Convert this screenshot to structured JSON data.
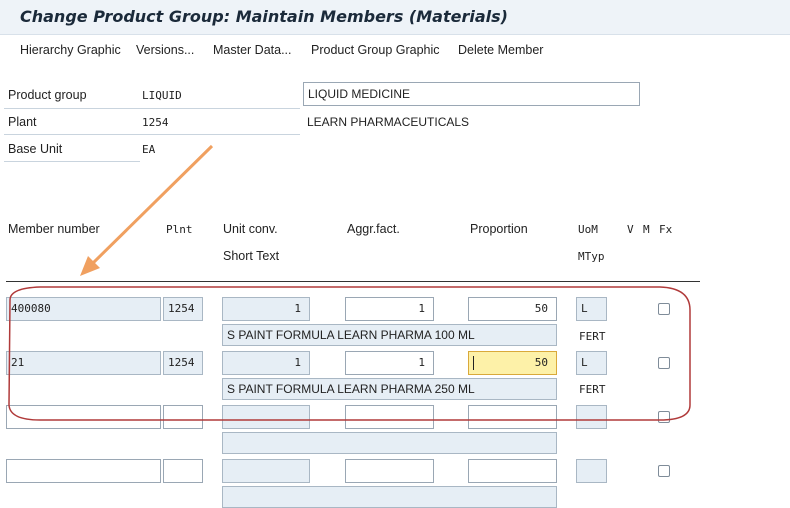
{
  "title": "Change Product Group: Maintain Members (Materials)",
  "menu": [
    "Hierarchy Graphic",
    "Versions...",
    "Master Data...",
    "Product Group Graphic",
    "Delete Member"
  ],
  "header": {
    "product_group_label": "Product group",
    "product_group_value": "LIQUID",
    "product_group_desc": "LIQUID MEDICINE",
    "plant_label": "Plant",
    "plant_value": "1254",
    "plant_desc": "LEARN PHARMACEUTICALS",
    "base_unit_label": "Base Unit",
    "base_unit_value": "EA"
  },
  "columns": {
    "member_number": "Member number",
    "plnt": "Plnt",
    "unit_conv": "Unit conv.",
    "aggr_fact": "Aggr.fact.",
    "proportion": "Proportion",
    "uom": "UoM",
    "v": "V",
    "m": "M",
    "fx": "Fx",
    "short_text": "Short Text",
    "mtyp": "MTyp"
  },
  "rows": [
    {
      "member": "400080",
      "plnt": "1254",
      "unit_conv": "1",
      "aggr_fact": "1",
      "proportion": "50",
      "uom": "L",
      "short_text": "S PAINT FORMULA LEARN PHARMA 100 ML",
      "mtyp": "FERT",
      "checked": false
    },
    {
      "member": "21",
      "plnt": "1254",
      "unit_conv": "1",
      "aggr_fact": "1",
      "proportion": "50",
      "uom": "L",
      "short_text": "S PAINT FORMULA LEARN PHARMA 250 ML",
      "mtyp": "FERT",
      "checked": false
    },
    {
      "member": "",
      "plnt": "",
      "unit_conv": "",
      "aggr_fact": "",
      "proportion": "",
      "uom": "",
      "short_text": "",
      "mtyp": "",
      "checked": false
    },
    {
      "member": "",
      "plnt": "",
      "unit_conv": "",
      "aggr_fact": "",
      "proportion": "",
      "uom": "",
      "short_text": "",
      "mtyp": "",
      "checked": false
    }
  ],
  "annotation": {
    "arrow_color": "#f0a060",
    "highlight_color": "#b03a3a"
  }
}
